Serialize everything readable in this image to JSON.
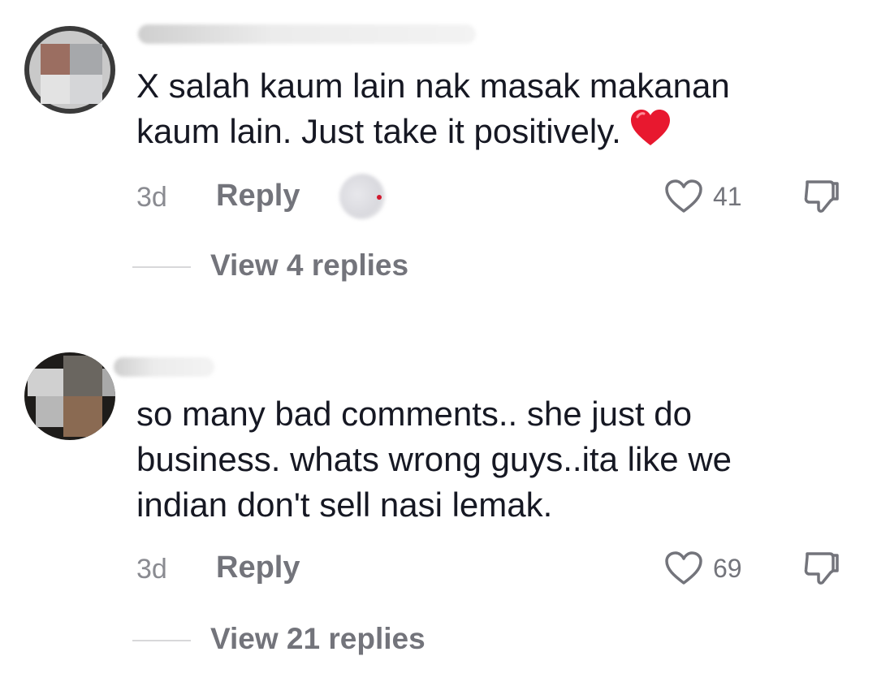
{
  "comments": [
    {
      "text_line1": "X salah kaum lain nak masak makanan",
      "text_line2": "kaum lain. Just take it positively.",
      "emoji": "red-heart",
      "time": "3d",
      "reply_label": "Reply",
      "likes": "41",
      "view_replies": "View 4 replies"
    },
    {
      "text_line1": "so many bad comments.. she just do",
      "text_line2": "business. whats wrong guys..ita like we",
      "text_line3": "indian don't sell nasi lemak.",
      "time": "3d",
      "reply_label": "Reply",
      "likes": "69",
      "view_replies": "View 21 replies"
    }
  ],
  "colors": {
    "text": "#161823",
    "secondary": "#73747b",
    "heart_emoji": "#e8182f",
    "background": "#ffffff"
  },
  "icons": [
    "heart-outline-icon",
    "thumbs-down-icon",
    "red-heart-emoji-icon"
  ]
}
